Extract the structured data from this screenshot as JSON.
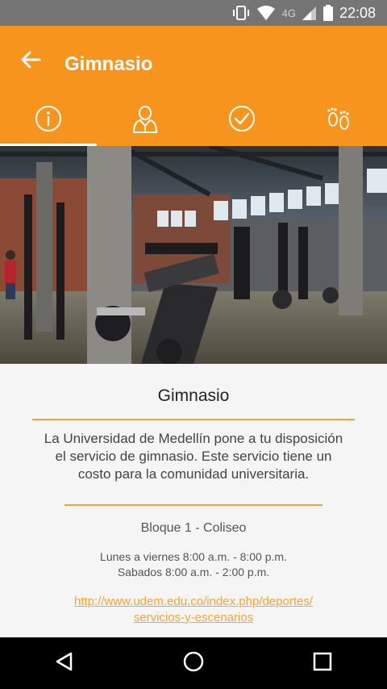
{
  "status_bar": {
    "time": "22:08",
    "network": "4G",
    "icons": [
      "vibrate-icon",
      "wifi-icon",
      "signal-icon",
      "battery-icon"
    ]
  },
  "app_bar": {
    "title": "Gimnasio",
    "back_icon": "arrow-back-icon",
    "background_color": "#f7941d"
  },
  "tabs": [
    {
      "icon": "info-icon",
      "active": true
    },
    {
      "icon": "person-icon",
      "active": false
    },
    {
      "icon": "check-circle-icon",
      "active": false
    },
    {
      "icon": "footprints-icon",
      "active": false
    }
  ],
  "content": {
    "title": "Gimnasio",
    "description": "La Universidad de Medellín pone a tu disposición el servicio de gimnasio. Este servicio tiene un costo para la comunidad universitaria.",
    "location": "Bloque 1 - Coliseo",
    "hours_weekdays": "Lunes a viernes 8:00 a.m. - 8:00 p.m.",
    "hours_saturday": "Sabados 8:00 a.m. - 2:00 p.m.",
    "link_line1": "http://www.udem.edu.co/index.php/deportes/",
    "link_line2": "servicios-y-escenarios",
    "accent_color": "#f7a234"
  },
  "nav_bar": {
    "buttons": [
      "back-triangle-icon",
      "home-circle-icon",
      "recents-square-icon"
    ]
  }
}
